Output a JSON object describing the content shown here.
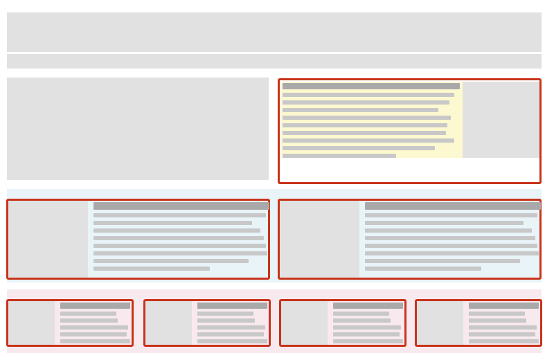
{
  "colors": {
    "placeholder": "#e1e1e1",
    "highlight_border": "#c8331a",
    "text_line": "#c8c8c8",
    "heading_line": "#a9a9a9",
    "panel_yellow": "#fcf8cf",
    "band_blue": "#e9f4f8",
    "band_pink": "#f8e9ef"
  },
  "layout": {
    "header": {
      "rows": [
        "banner",
        "nav-bar"
      ]
    },
    "row_1": {
      "left": "placeholder-block",
      "right": "highlighted-card-yellow",
      "card_text_lines": 10
    },
    "row_2": {
      "cards": 2,
      "card_text_lines": 9
    },
    "row_3": {
      "cards": 4,
      "card_text_lines": 6
    }
  }
}
